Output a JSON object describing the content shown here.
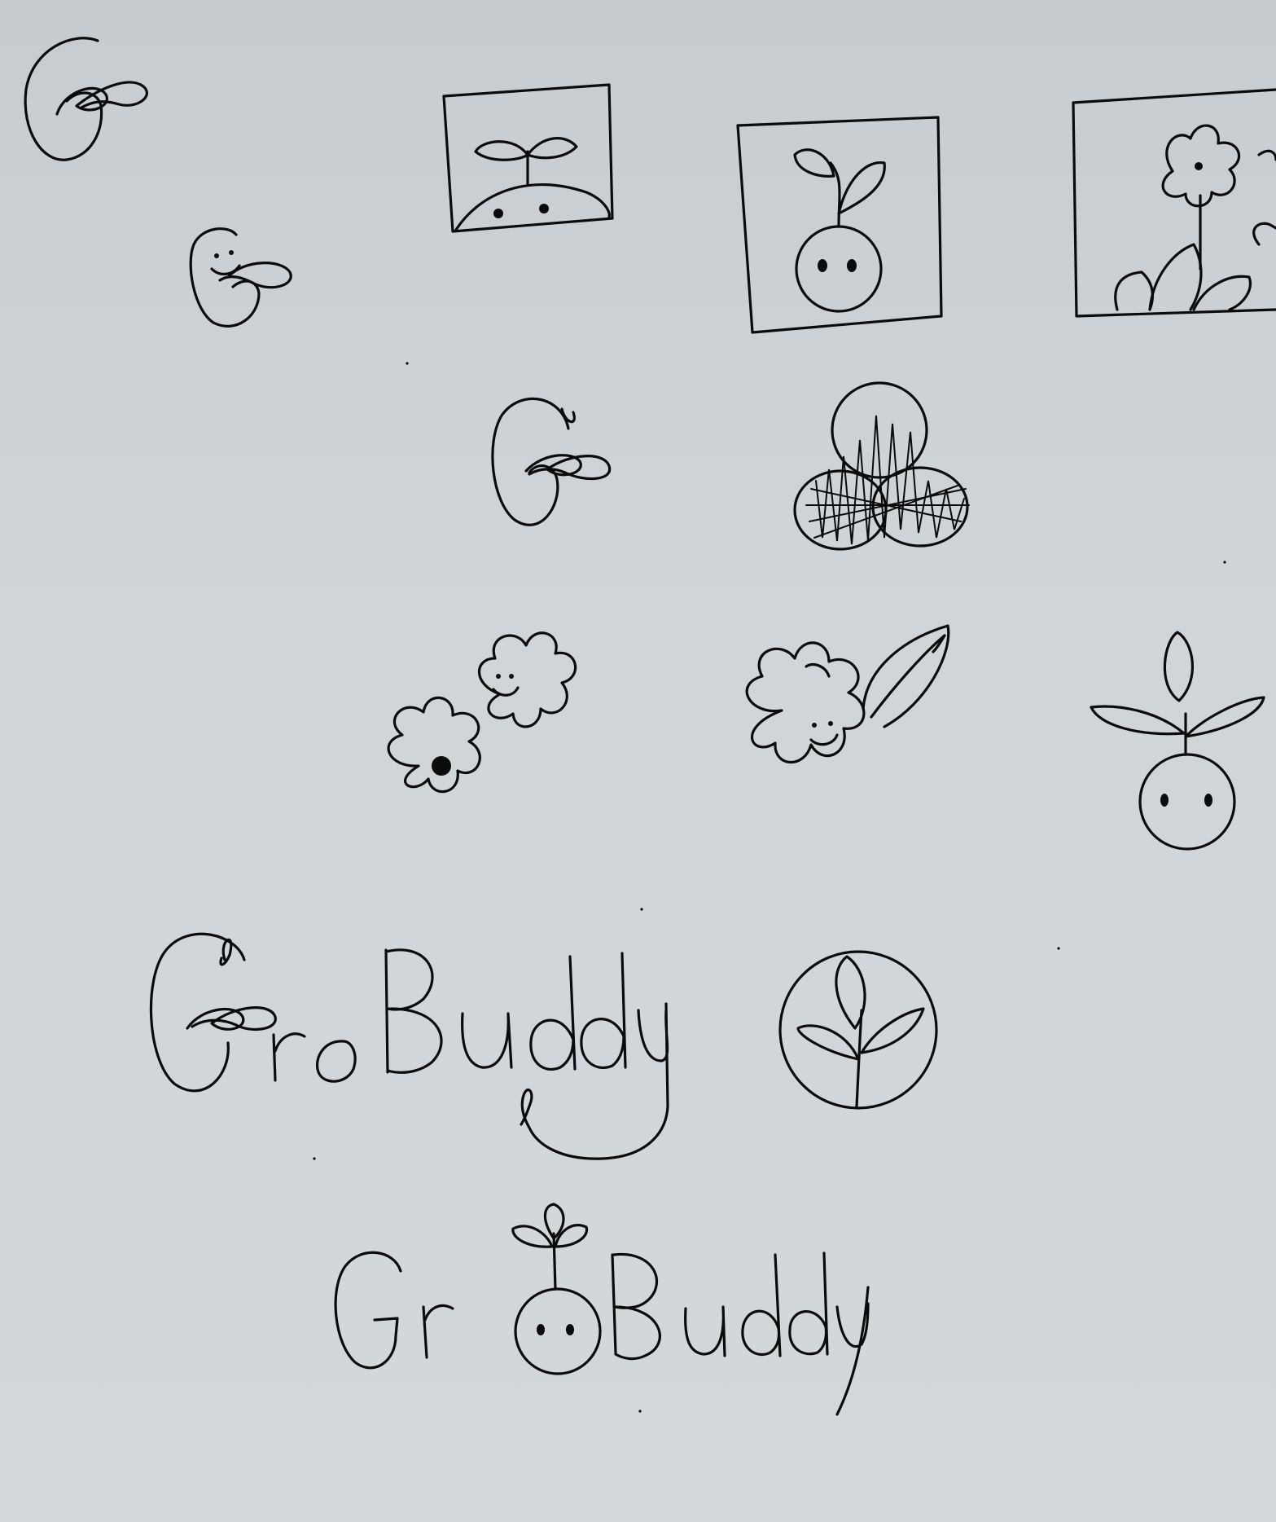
{
  "sketch": {
    "wordmark_1": "GroBuddy",
    "wordmark_2": "GroBuddy",
    "ink_color": "#0b0b0b",
    "paper_color": "#ccd2d5"
  }
}
